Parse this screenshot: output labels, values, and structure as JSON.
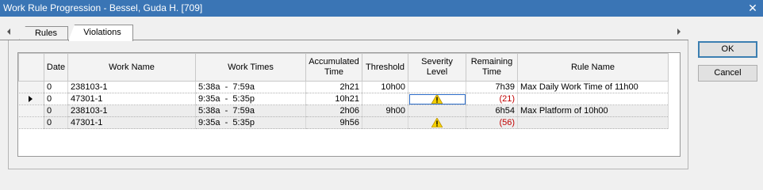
{
  "window": {
    "title": "Work Rule Progression - Bessel, Guda H. [709]",
    "close_label": "✕"
  },
  "tabs": [
    {
      "label": "Rules"
    },
    {
      "label": "Violations"
    }
  ],
  "columns": [
    "Date",
    "Work Name",
    "Work Times",
    "Accumulated Time",
    "Threshold",
    "Severity Level",
    "Remaining Time",
    "Rule Name"
  ],
  "rows": [
    {
      "date": "0",
      "work_name": "238103-1",
      "work_times": "5:38a  -  7:59a",
      "accumulated": "2h21",
      "threshold": "10h00",
      "severity": "",
      "remaining": "7h39",
      "rule": "Max Daily Work Time of 11h00"
    },
    {
      "date": "0",
      "work_name": "47301-1",
      "work_times": "9:35a  -  5:35p",
      "accumulated": "10h21",
      "threshold": "",
      "severity": "warning",
      "remaining": "(21)",
      "rule": ""
    },
    {
      "date": "0",
      "work_name": "238103-1",
      "work_times": "5:38a  -  7:59a",
      "accumulated": "2h06",
      "threshold": "9h00",
      "severity": "",
      "remaining": "6h54",
      "rule": "Max Platform of 10h00"
    },
    {
      "date": "0",
      "work_name": "47301-1",
      "work_times": "9:35a  -  5:35p",
      "accumulated": "9h56",
      "threshold": "",
      "severity": "warning",
      "remaining": "(56)",
      "rule": ""
    }
  ],
  "buttons": {
    "ok": "OK",
    "cancel": "Cancel"
  },
  "colors": {
    "titlebar": "#3a75b5",
    "warning_icon": "#f5d000",
    "negative_text": "#c00000"
  }
}
